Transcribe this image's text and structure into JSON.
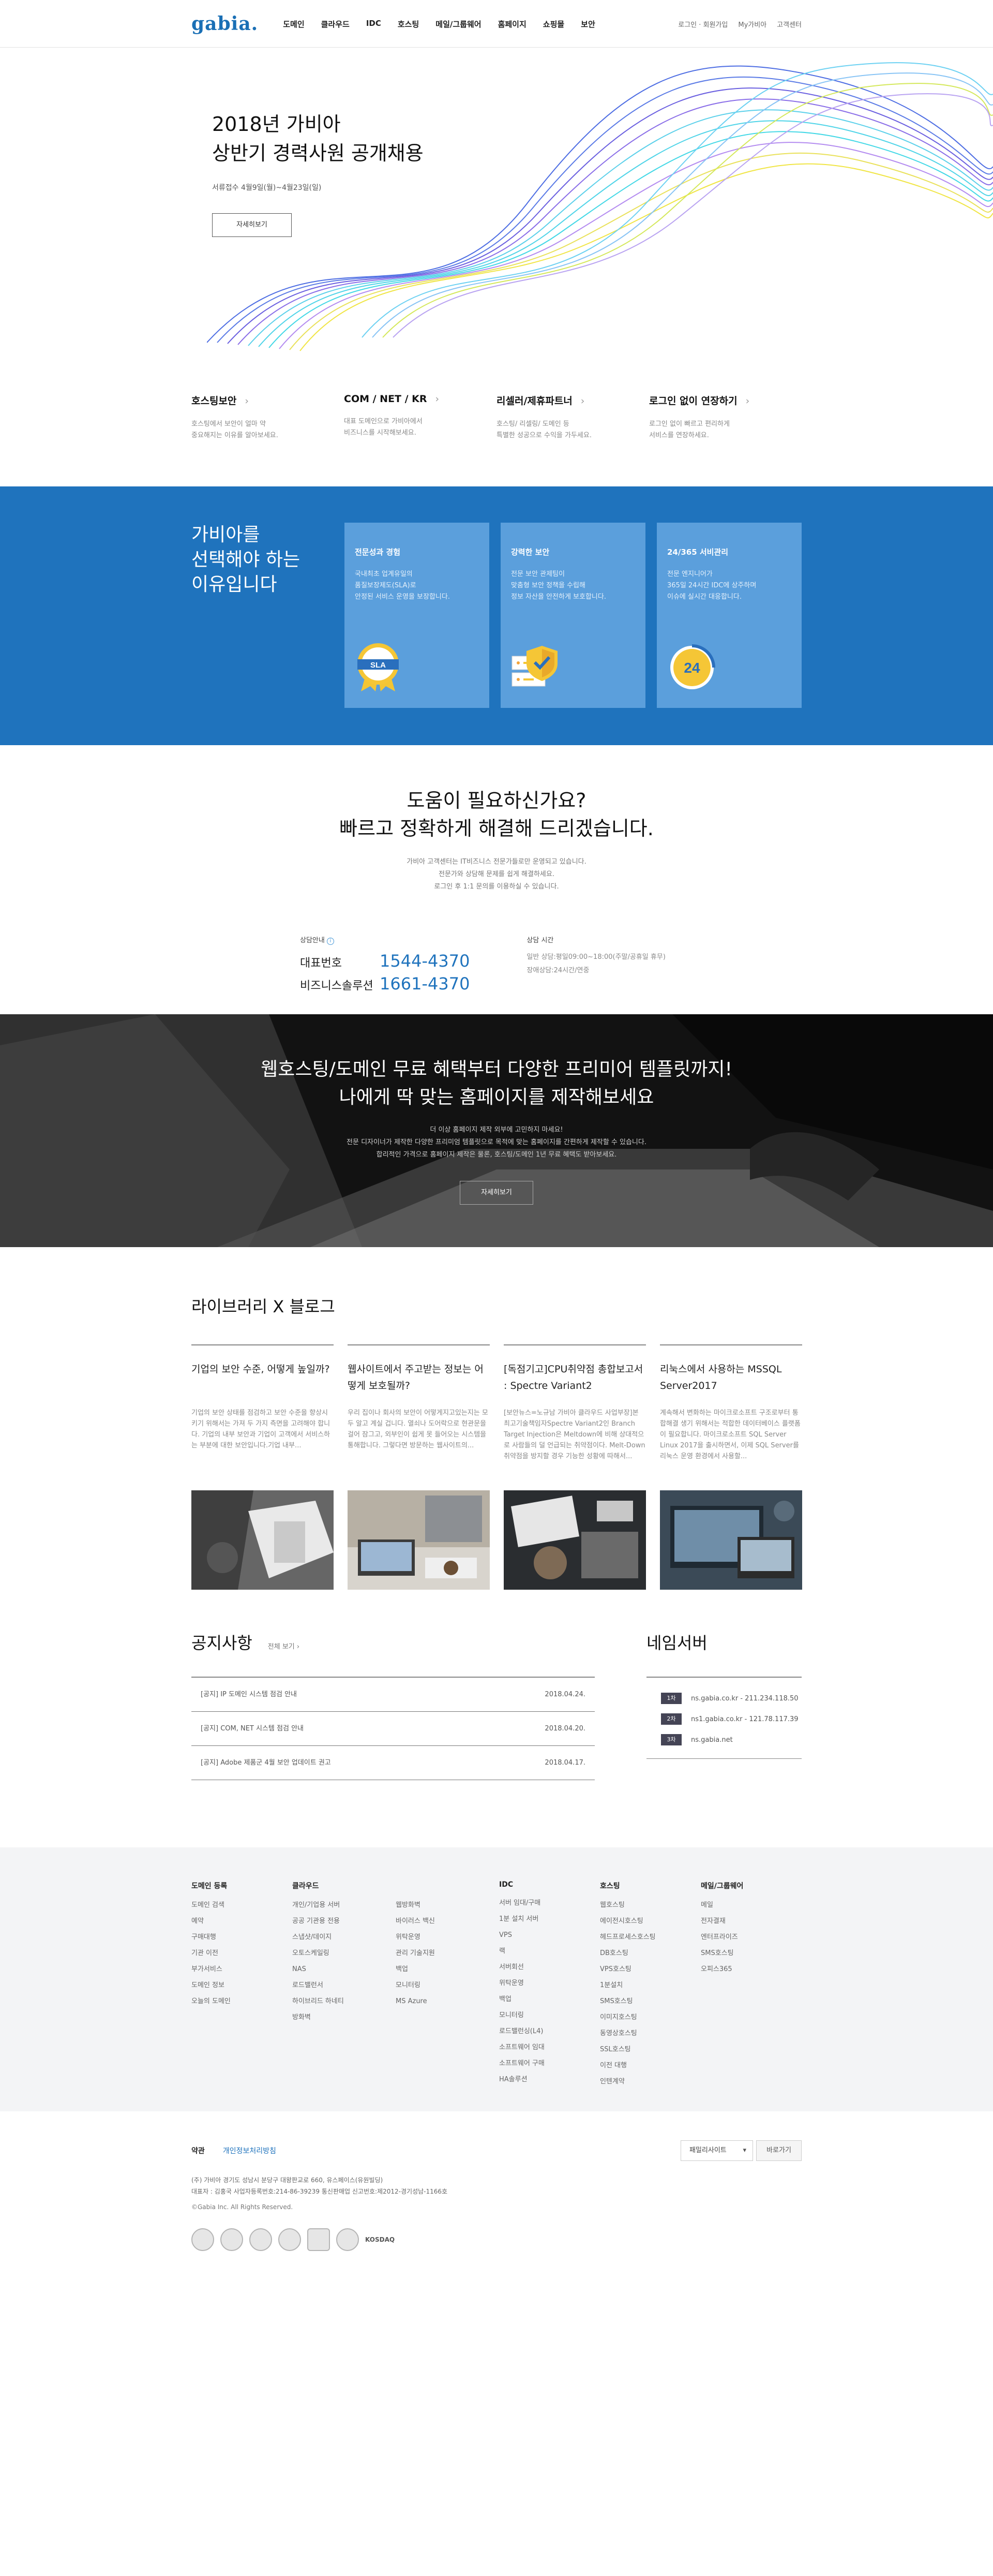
{
  "header": {
    "logo": "gabia.",
    "nav": [
      "도메인",
      "클라우드",
      "IDC",
      "호스팅",
      "메일/그룹웨어",
      "홈페이지",
      "쇼핑몰",
      "보안"
    ],
    "util": [
      "로그인 · 회원가입",
      "My가비아",
      "고객센터"
    ]
  },
  "hero": {
    "title_line1": "2018년 가비아",
    "title_line2": "상반기 경력사원 공개채용",
    "sub": "서류접수 4월9일(월)~4월23일(일)",
    "button": "자세히보기"
  },
  "quick": [
    {
      "title": "호스팅보안",
      "line1": "호스팅에서 보안이 얼마 약",
      "line2": "중요해지는 이유를 알아보세요."
    },
    {
      "title": "COM / NET / KR",
      "line1": "대표 도메인으로 가비아에서",
      "line2": "비즈니스를 시작해보세요."
    },
    {
      "title": "리셀러/제휴파트너",
      "line1": "호스팅/ 리셀링/ 도메인 등",
      "line2": "특별한 성공으로 수익을 가두세요."
    },
    {
      "title": "로그인 없이 연장하기",
      "line1": "로그인 없이 빠르고 편리하게",
      "line2": "서비스를 연장하세요."
    }
  ],
  "why": {
    "title_line1": "가비아를",
    "title_line2": "선택해야 하는",
    "title_line3": "이유입니다",
    "cards": [
      {
        "title": "전문성과 경험",
        "line1": "국내최초 업계유일의",
        "line2": "품질보장제도(SLA)로",
        "line3": "안정된 서비스 운영을 보장합니다.",
        "badge": "SLA"
      },
      {
        "title": "강력한 보안",
        "line1": "전문 보안 관제팀이",
        "line2": "맞춤형 보안 정책을 수립해",
        "line3": "정보 자산을 안전하게 보호합니다."
      },
      {
        "title": "24/365 서비관리",
        "line1": "전문 엔지니어가",
        "line2": "365일 24시간 IDC에 상주하며",
        "line3": "이슈에 실시간 대응합니다.",
        "badge": "24"
      }
    ]
  },
  "help": {
    "title_line1": "도움이 필요하신가요?",
    "title_line2": "빠르고 정확하게 해결해 드리겠습니다.",
    "desc1": "가비아 고객센터는 IT비즈니스 전문가들로만 운영되고 있습니다.",
    "desc2": "전문가와 상담해 문제를 쉽게 해결하세요.",
    "desc3": "로그인 후 1:1 문의를 이용하실 수 있습니다.",
    "consult_label": "상담안내",
    "rows": [
      {
        "k": "대표번호",
        "v": "1544-4370"
      },
      {
        "k": "비즈니스솔루션",
        "v": "1661-4370"
      }
    ],
    "hours_label": "상담 시간",
    "hours1": "일반 상담:평일09:00~18:00(주말/공휴일 휴무)",
    "hours2": "장애상담:24시간/연중"
  },
  "promo": {
    "title_line1": "웹호스팅/도메인 무료 혜택부터 다양한 프리미어 템플릿까지!",
    "title_line2": "나에게 딱 맞는 홈페이지를 제작해보세요",
    "d1": "더 이상 홈페이지 제작 외부에 고민하지 마세요!",
    "d2": "전문 디자이너가 제작한 다양한 프리미엄 템플릿으로 목적에 맞는 홈페이지를 간편하게 제작할 수 있습니다.",
    "d3": "합리적인 가격으로 홈페이지 제작은 물론, 호스팅/도메인 1년 무료 혜택도 받아보세요.",
    "button": "자세히보기"
  },
  "blog": {
    "title": "라이브러리 X 블로그",
    "posts": [
      {
        "title": "기업의 보안 수준, 어떻게 높일까?",
        "body": "기업의 보안 상태를 점검하고 보안 수준을 향상시키기 위해서는 가져 두 가지 측면을 고려해야 합니다. 기업의 내부 보안과 기업이 고객에서 서비스하는 부분에 대한 보안입니다.기업 내부..."
      },
      {
        "title": "웹사이트에서 주고받는 정보는 어떻게 보호될까?",
        "body": "우리 집이나 회사의 보안이 어떻게지고있는지는 모두 알고 계실 겁니다. 열쇠나 도어락으로 현관문을 걸어 잠그고, 외부인이 쉽게 못 들어오는 시스템을 통해합니다. 그렇다면 방문하는 웹사이트의..."
      },
      {
        "title": "[독점기고]CPU취약점 총합보고서 : Spectre Variant2",
        "body": "[보안뉴스=노규남 가비아 클라우드 사업부장]본 최고기술책임자Spectre Variant2인 Branch Target Injection은 Meltdown에 비해 상대적으로 사람들의 덜 언급되는 취약점이다. Melt-Down 취약점을 방지할 경우 기능한 성황에 따해서..."
      },
      {
        "title": "리눅스에서 사용하는 MSSQL Server2017",
        "body": "계속해서 변화하는 마이크로소프트 구조로부터 통합해결 생기 위해서는 적합한 데이터베이스 플랫폼이 필요합니다. 마이크로소프트 SQL Server Linux 2017을 출시하면서, 이제 SQL Server를 리눅스 운영 환경에서 사용할..."
      }
    ]
  },
  "notice": {
    "title": "공지사항",
    "more": "전체 보기",
    "items": [
      {
        "text": "[공지] IP 도메인 시스템 점검 안내",
        "date": "2018.04.24."
      },
      {
        "text": "[공지] COM, NET 시스템 점검 안내",
        "date": "2018.04.20."
      },
      {
        "text": "[공지] Adobe 제품군 4월 보안 업데이트 권고",
        "date": "2018.04.17."
      }
    ]
  },
  "nameserver": {
    "title": "네임서버",
    "items": [
      {
        "badge": "1차",
        "text": "ns.gabia.co.kr - 211.234.118.50"
      },
      {
        "badge": "2차",
        "text": "ns1.gabia.co.kr - 121.78.117.39"
      },
      {
        "badge": "3차",
        "text": "ns.gabia.net"
      }
    ]
  },
  "sitemap": {
    "domain": {
      "title": "도메인 등록",
      "items": [
        "도메인 검색",
        "예약",
        "구매대행",
        "기관 이전",
        "부가서비스",
        "도메인 정보",
        "오늘의 도메인"
      ]
    },
    "cloud": {
      "title": "클라우드",
      "col1": [
        "개인/기업용 서버",
        "공공 기관용 전용",
        "스냅샷/데이지",
        "오토스케일링",
        "NAS",
        "로드밸런서",
        "하이브리드 하네티",
        "방화벽"
      ],
      "col2": [
        "웹방화벽",
        "바이러스 백신",
        "위탁운영",
        "관리 기술지원",
        "백업",
        "모니터링",
        "MS Azure"
      ]
    },
    "idc": {
      "title": "IDC",
      "items": [
        "서버 임대/구매",
        "1분 설치 서버",
        "VPS",
        "랙",
        "서버회선",
        "위탁운영",
        "백업",
        "모니터링",
        "로드밸런싱(L4)",
        "소프트웨어 임대",
        "소프트웨어 구매",
        "HA솔루션"
      ]
    },
    "hosting": {
      "title": "호스팅",
      "items": [
        "웹호스팅",
        "에이전시호스팅",
        "헤드프로세스호스팅",
        "DB호스팅",
        "VPS호스팅",
        "1분설치",
        "SMS호스팅",
        "이미지호스팅",
        "동영상호스팅",
        "SSL호스팅",
        "이전 대행",
        "인텐계약"
      ]
    },
    "mail": {
      "title": "메일/그룹웨어",
      "items": [
        "메일",
        "전자결재",
        "엔터프라이즈",
        "SMS호스팅",
        "오피스365"
      ]
    }
  },
  "footer": {
    "link1": "약관",
    "link2": "개인정보처리방침",
    "family": "패밀리사이트",
    "go": "바로가기",
    "addr1": "(주) 가비아     경기도 성남시 분당구 대왕판교로 660, 유스페이스(유원빌딩)",
    "addr2": "대표자 : 김홍국     사업자등록번호:214-86-39239     통신판매업 신고번호:제2012-경기성남-1166호",
    "copy": "©Gabia Inc. All Rights Reserved.",
    "cert_text": "KOSDAQ"
  },
  "colors": {
    "brand": "#1f73bd",
    "card": "#5b9fdc",
    "dark": "#1d1d1d"
  }
}
